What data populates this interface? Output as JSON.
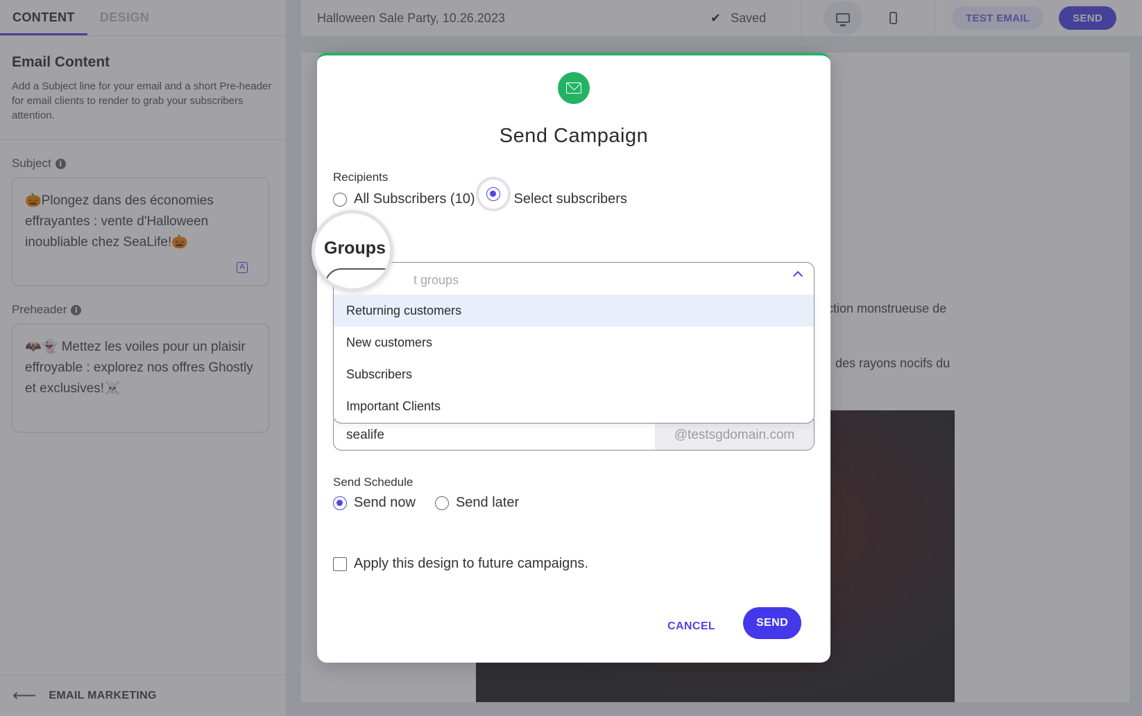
{
  "left_panel": {
    "tabs": [
      {
        "label": "CONTENT"
      },
      {
        "label": "DESIGN"
      }
    ],
    "section_title": "Email Content",
    "section_desc": "Add a Subject line for your email and a short Pre-header for email clients to render to grab your subscribers attention.",
    "subject_label": "Subject",
    "subject_value": "🎃Plongez dans des économies effrayantes : vente d'Halloween inoubliable chez SeaLife!🎃",
    "preheader_label": "Preheader",
    "preheader_value": "🦇👻 Mettez les voiles pour un plaisir effroyable : explorez nos offres Ghostly et exclusives!☠️",
    "footer_label": "EMAIL MARKETING"
  },
  "topbar": {
    "campaign_title": "Halloween Sale Party, 10.26.2023",
    "saved_label": "Saved",
    "test_email_label": "TEST EMAIL",
    "send_label": "SEND"
  },
  "canvas": {
    "text_line_1": "ction monstrueuse de",
    "text_line_2": "des rayons nocifs du"
  },
  "modal": {
    "title": "Send Campaign",
    "recipients_label": "Recipients",
    "recipients_options": {
      "all": "All Subscribers (10)",
      "select": "Select subscribers",
      "selected": "select"
    },
    "groups_label": "Groups",
    "groups_placeholder": "Select groups",
    "groups_options": [
      "Returning customers",
      "New customers",
      "Subscribers",
      "Important Clients"
    ],
    "sender_value": "sealife",
    "sender_domain": "@testsgdomain.com",
    "schedule_label": "Send Schedule",
    "schedule_options": {
      "now": "Send now",
      "later": "Send later",
      "selected": "now"
    },
    "apply_design_label": "Apply this design to future campaigns.",
    "cancel_label": "CANCEL",
    "send_label": "SEND"
  },
  "colors": {
    "accent": "#4f46e5",
    "success": "#22b463"
  }
}
